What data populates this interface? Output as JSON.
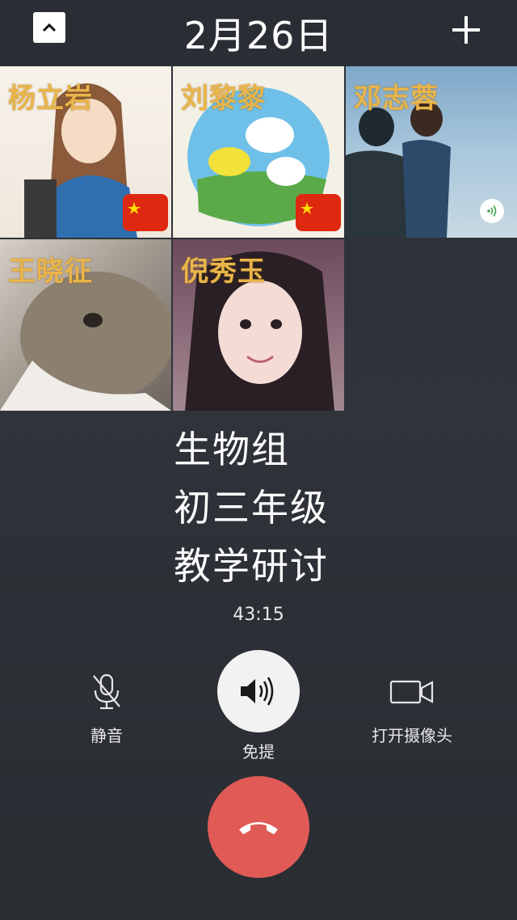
{
  "header": {
    "date": "2月26日"
  },
  "participants": [
    {
      "name": "杨立岩",
      "flag": true
    },
    {
      "name": "刘黎黎",
      "flag": true
    },
    {
      "name": "邓志蓉",
      "flag": false,
      "speaking": true
    },
    {
      "name": "王晓征",
      "flag": false
    },
    {
      "name": "倪秀玉",
      "flag": false
    }
  ],
  "overlay_text": {
    "line1": "生物组",
    "line2": "初三年级",
    "line3": "教学研讨"
  },
  "call": {
    "duration": "43:15"
  },
  "controls": {
    "mute_label": "静音",
    "speaker_label": "免提",
    "camera_label": "打开摄像头"
  },
  "icons": {
    "collapse": "chevron-up-icon",
    "add": "plus-icon",
    "mute": "microphone-off-icon",
    "speaker": "speaker-icon",
    "camera": "video-camera-icon",
    "hangup": "phone-hangup-icon"
  },
  "colors": {
    "hangup": "#e05a56",
    "name_label": "#e8b54a",
    "speaking_indicator": "#3aa84f"
  }
}
